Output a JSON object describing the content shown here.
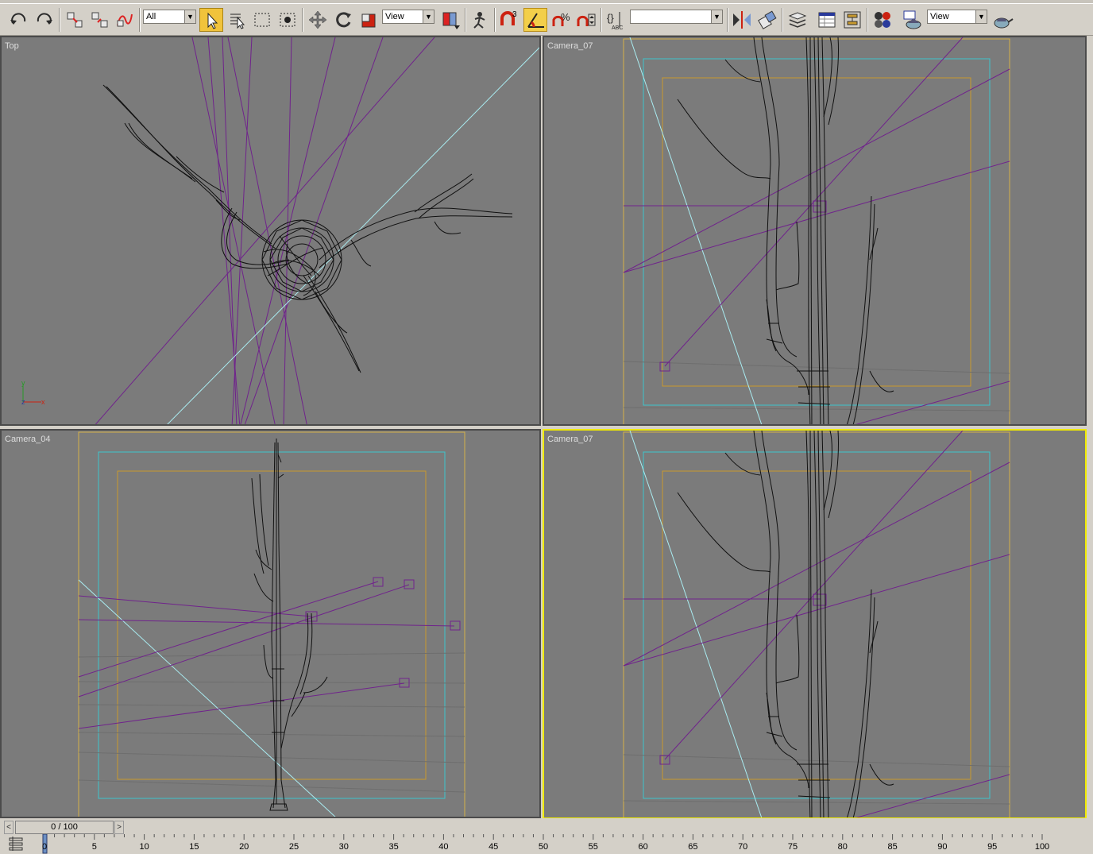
{
  "toolbar": {
    "selection_filter": "All",
    "reference_coord": "View",
    "named_selection": "",
    "render_view": "View",
    "buttons": [
      {
        "icon": "undo-icon"
      },
      {
        "icon": "redo-icon"
      },
      {
        "icon": "link-icon"
      },
      {
        "icon": "unlink-icon"
      },
      {
        "icon": "bind-space-warp-icon"
      },
      {
        "icon": "select-object-icon"
      },
      {
        "icon": "select-by-name-icon"
      },
      {
        "icon": "rectangular-region-icon"
      },
      {
        "icon": "window-crossing-icon"
      },
      {
        "icon": "select-move-icon"
      },
      {
        "icon": "select-rotate-icon"
      },
      {
        "icon": "select-scale-icon"
      },
      {
        "icon": "use-pivot-center-icon"
      },
      {
        "icon": "manipulate-icon"
      },
      {
        "icon": "snap-3d-icon"
      },
      {
        "icon": "angle-snap-icon"
      },
      {
        "icon": "percent-snap-icon"
      },
      {
        "icon": "spinner-snap-icon"
      },
      {
        "icon": "named-selection-sets-icon"
      },
      {
        "icon": "mirror-icon"
      },
      {
        "icon": "align-icon"
      },
      {
        "icon": "layer-manager-icon"
      },
      {
        "icon": "curve-editor-icon"
      },
      {
        "icon": "schematic-view-icon"
      },
      {
        "icon": "material-editor-icon"
      },
      {
        "icon": "render-scene-icon"
      },
      {
        "icon": "quick-render-icon"
      }
    ]
  },
  "viewports": [
    {
      "label": "Top",
      "active": false
    },
    {
      "label": "Camera_07",
      "active": false
    },
    {
      "label": "Camera_04",
      "active": false
    },
    {
      "label": "Camera_07",
      "active": true
    }
  ],
  "timeline": {
    "slider_label": "0 / 100",
    "prev_label": "<",
    "next_label": ">",
    "ticks": [
      "0",
      "5",
      "10",
      "15",
      "20",
      "25",
      "30",
      "35",
      "40",
      "45",
      "50",
      "55",
      "60",
      "65",
      "70",
      "75",
      "80",
      "85",
      "90",
      "95",
      "100"
    ],
    "current_frame": 0,
    "total_frames": 100
  },
  "colors": {
    "viewport_bg": "#7b7b7b",
    "active_border": "#f0ea00",
    "light_lines": "#70238c",
    "camera_lines": "#a9ecf1",
    "safe_frame_outer": "#d4b14a",
    "safe_frame_mid": "#3ec6cc",
    "safe_frame_inner": "#c89a2e",
    "wireframe": "#101010"
  }
}
